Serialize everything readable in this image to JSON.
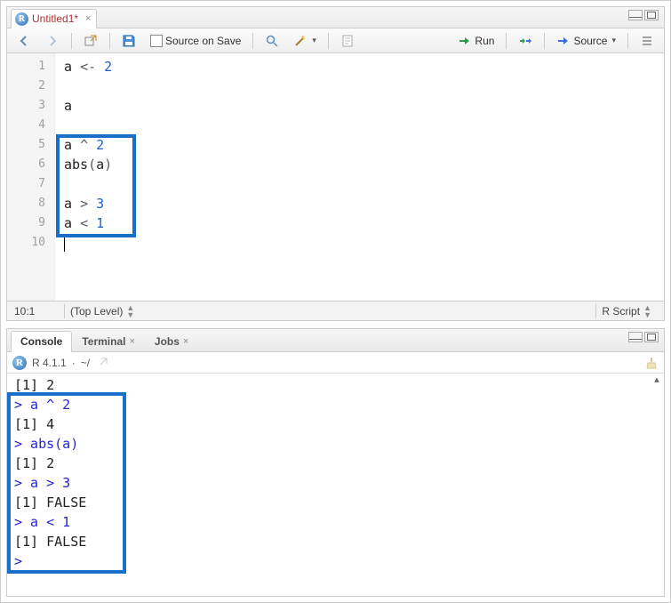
{
  "editor": {
    "tab": {
      "title": "Untitled1*",
      "badge_letter": "R"
    },
    "toolbar": {
      "source_on_save_label": "Source on Save",
      "run_label": "Run",
      "source_label": "Source"
    },
    "gutter": [
      "1",
      "2",
      "3",
      "4",
      "5",
      "6",
      "7",
      "8",
      "9",
      "10"
    ],
    "code_lines": [
      {
        "type": "code",
        "tokens": [
          {
            "t": "a",
            "c": "id"
          },
          {
            "t": " "
          },
          {
            "t": "<-",
            "c": "op"
          },
          {
            "t": " "
          },
          {
            "t": "2",
            "c": "num"
          }
        ]
      },
      {
        "type": "blank"
      },
      {
        "type": "code",
        "tokens": [
          {
            "t": "a",
            "c": "id"
          }
        ]
      },
      {
        "type": "blank"
      },
      {
        "type": "code",
        "tokens": [
          {
            "t": "a",
            "c": "id"
          },
          {
            "t": " "
          },
          {
            "t": "^",
            "c": "op"
          },
          {
            "t": " "
          },
          {
            "t": "2",
            "c": "num"
          }
        ]
      },
      {
        "type": "code",
        "tokens": [
          {
            "t": "abs",
            "c": "fn"
          },
          {
            "t": "(",
            "c": "op"
          },
          {
            "t": "a",
            "c": "id"
          },
          {
            "t": ")",
            "c": "op"
          }
        ]
      },
      {
        "type": "blank"
      },
      {
        "type": "code",
        "tokens": [
          {
            "t": "a",
            "c": "id"
          },
          {
            "t": " "
          },
          {
            "t": ">",
            "c": "op"
          },
          {
            "t": " "
          },
          {
            "t": "3",
            "c": "num"
          }
        ]
      },
      {
        "type": "code",
        "tokens": [
          {
            "t": "a",
            "c": "id"
          },
          {
            "t": " "
          },
          {
            "t": "<",
            "c": "op"
          },
          {
            "t": " "
          },
          {
            "t": "1",
            "c": "num"
          }
        ]
      },
      {
        "type": "cursor"
      }
    ],
    "status": {
      "cursor_pos": "10:1",
      "scope": "(Top Level)",
      "filetype": "R Script"
    }
  },
  "console": {
    "tabs": [
      {
        "label": "Console",
        "active": true,
        "closable": false
      },
      {
        "label": "Terminal",
        "active": false,
        "closable": true
      },
      {
        "label": "Jobs",
        "active": false,
        "closable": true
      }
    ],
    "header": {
      "badge_letter": "R",
      "version": "R 4.1.1",
      "dot": "·",
      "path": "~/"
    },
    "lines": [
      {
        "kind": "out",
        "text": "[1] 2"
      },
      {
        "kind": "in",
        "text": "> a ^ 2"
      },
      {
        "kind": "out",
        "text": "[1] 4"
      },
      {
        "kind": "in",
        "text": "> abs(a)"
      },
      {
        "kind": "out",
        "text": "[1] 2"
      },
      {
        "kind": "in",
        "text": "> a > 3"
      },
      {
        "kind": "out",
        "text": "[1] FALSE"
      },
      {
        "kind": "in",
        "text": "> a < 1"
      },
      {
        "kind": "out",
        "text": "[1] FALSE"
      },
      {
        "kind": "in",
        "text": "> "
      }
    ]
  }
}
